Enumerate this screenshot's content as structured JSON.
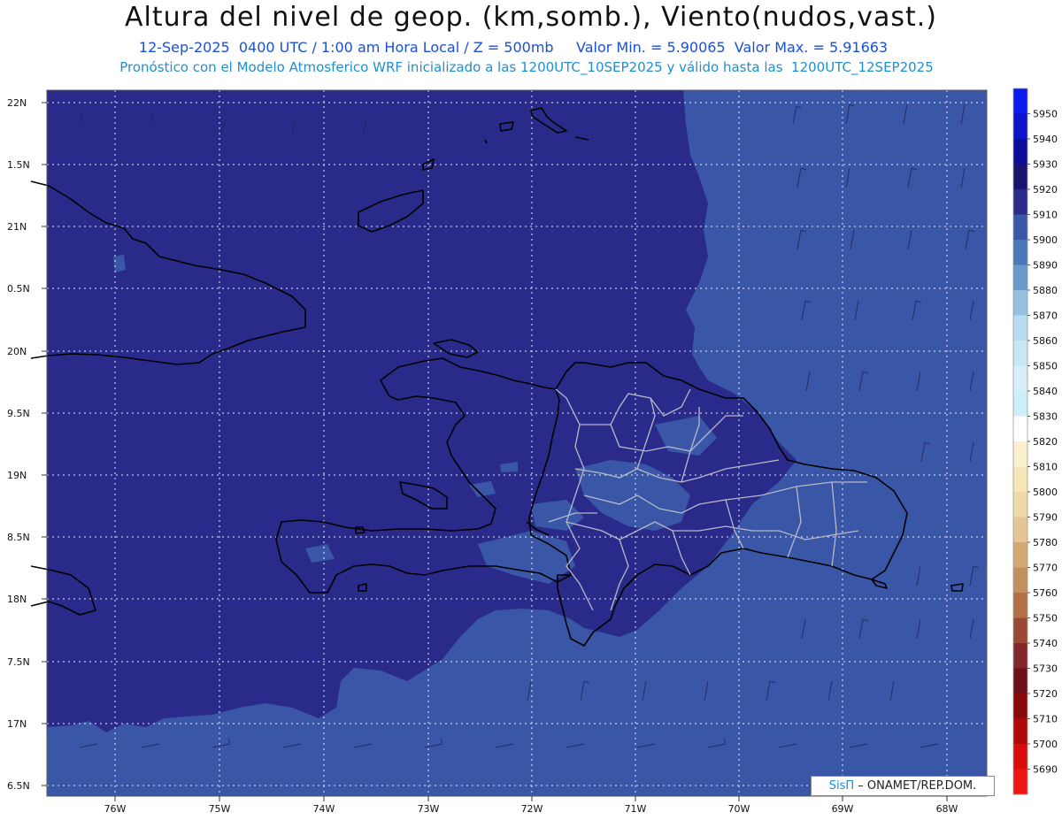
{
  "title": "Altura del nivel de geop. (km,somb.), Viento(nudos,vast.)",
  "subtitle": "12-Sep-2025  0400 UTC / 1:00 am Hora Local / Z = 500mb     Valor Min. = 5.90065  Valor Max. = 5.91663",
  "forecast_note": "Pronóstico con el Modelo Atmosferico WRF inicializado a las 1200UTC_10SEP2025 y válido hasta las  1200UTC_12SEP2025",
  "credit": {
    "logo": "SisΠ",
    "text": " – ONAMET/REP.DOM."
  },
  "colors": {
    "deep_fill": "#2a2a8a",
    "mid_fill": "#3a56a6",
    "light_fill": "#4a6fb8",
    "grid": "#ffffff",
    "coast": "#000000",
    "province": "#b8b8c8"
  },
  "lat_labels": [
    "22N",
    "1.5N",
    "21N",
    "0.5N",
    "20N",
    "9.5N",
    "19N",
    "8.5N",
    "18N",
    "7.5N",
    "17N",
    "6.5N"
  ],
  "lon_labels": [
    "76W",
    "75W",
    "74W",
    "73W",
    "72W",
    "71W",
    "70W",
    "69W",
    "68W"
  ],
  "colorbar": {
    "labels": [
      "5950",
      "5940",
      "5930",
      "5920",
      "5910",
      "5900",
      "5890",
      "5880",
      "5870",
      "5860",
      "5850",
      "5840",
      "5830",
      "5820",
      "5810",
      "5800",
      "5790",
      "5780",
      "5770",
      "5760",
      "5750",
      "5740",
      "5730",
      "5720",
      "5710",
      "5700",
      "5690"
    ],
    "colors": [
      "#0a1cf0",
      "#0f12c8",
      "#0c0c9a",
      "#1a1470",
      "#2a2a8a",
      "#3a56a6",
      "#4a78b8",
      "#6a98cc",
      "#95c0e0",
      "#b8dcef",
      "#c8e6f4",
      "#d8eef8",
      "#cdeff8",
      "#ffffff",
      "#faf0cc",
      "#f5e6b8",
      "#efd9a6",
      "#e6c594",
      "#d4a873",
      "#c48f5e",
      "#b36f46",
      "#9a4a34",
      "#82282a",
      "#6e101a",
      "#8a0a0a",
      "#b00808",
      "#d80c0c",
      "#f01414"
    ]
  }
}
